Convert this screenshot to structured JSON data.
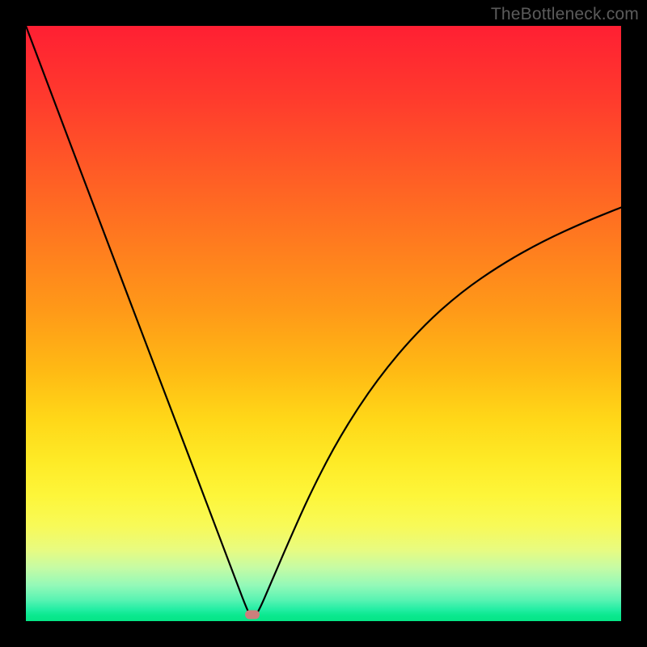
{
  "watermark": "TheBottleneck.com",
  "chart_data": {
    "type": "line",
    "title": "",
    "xlabel": "",
    "ylabel": "",
    "xlim": [
      0,
      100
    ],
    "ylim": [
      0,
      100
    ],
    "background_gradient": {
      "top": "#ff1f33",
      "bottom": "#05e586",
      "type": "vertical-rainbow-red-to-green"
    },
    "minimum_marker": {
      "x": 38,
      "y": 0,
      "color": "#cc7f7c"
    },
    "series": [
      {
        "name": "bottleneck-curve",
        "color": "#000000",
        "x": [
          0,
          5,
          10,
          15,
          20,
          25,
          30,
          35,
          37,
          38,
          39,
          41,
          44,
          48,
          53,
          59,
          66,
          73,
          80,
          87,
          94,
          100
        ],
        "y": [
          100,
          86.7,
          73.5,
          60.3,
          47.1,
          34.0,
          20.8,
          7.6,
          2.3,
          0.3,
          1.4,
          6.0,
          13.0,
          22.0,
          31.5,
          40.6,
          48.9,
          55.2,
          60.0,
          63.9,
          67.1,
          69.5
        ]
      }
    ]
  }
}
